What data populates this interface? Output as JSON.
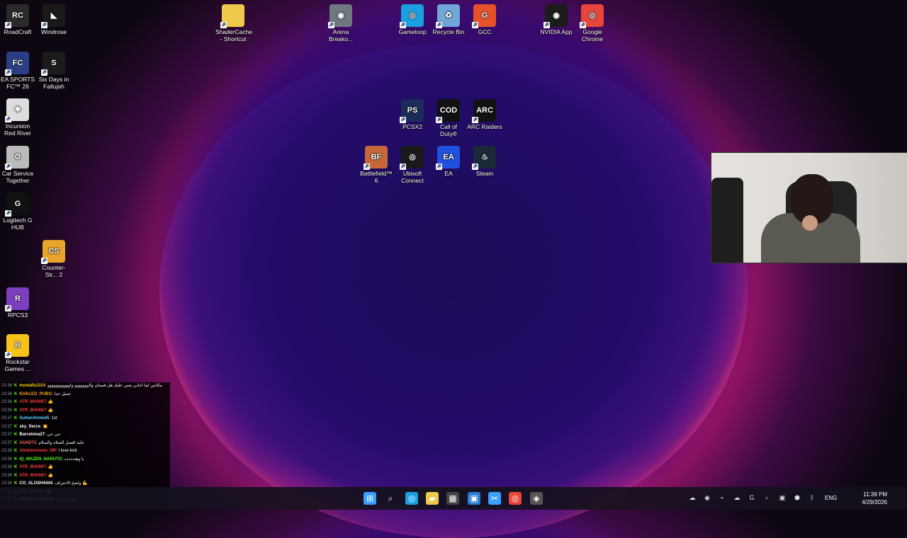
{
  "desktop_icons": [
    {
      "label": "RoadCraft",
      "icon": "roadcraft-icon",
      "color": "#2a2a2a",
      "glyph": "RC"
    },
    {
      "label": "Windrose",
      "icon": "windrose-icon",
      "color": "#1a1a1a",
      "glyph": "◣"
    },
    {
      "label": "ShaderCache - Shortcut",
      "icon": "folder-icon",
      "color": "#f0c94a",
      "glyph": ""
    },
    {
      "label": "Arena Breako...",
      "icon": "arena-breakout-icon",
      "color": "#6f7a80",
      "glyph": "◉"
    },
    {
      "label": "Gameloop",
      "icon": "gameloop-icon",
      "color": "#1aa0e0",
      "glyph": "◎"
    },
    {
      "label": "Recycle Bin",
      "icon": "recycle-bin-icon",
      "color": "#6fa6d6",
      "glyph": "♻"
    },
    {
      "label": "GCC",
      "icon": "gcc-icon",
      "color": "#e5522a",
      "glyph": "G"
    },
    {
      "label": "NVIDIA App",
      "icon": "nvidia-icon",
      "color": "#1c1c1c",
      "glyph": "◉"
    },
    {
      "label": "Google Chrome",
      "icon": "chrome-icon",
      "color": "#e8453c",
      "glyph": "◎"
    },
    {
      "label": "EA SPORTS FC™ 26",
      "icon": "ea-fc-icon",
      "color": "#2b3f86",
      "glyph": "FC"
    },
    {
      "label": "Six Days in Fallujah",
      "icon": "six-days-icon",
      "color": "#1b1b1b",
      "glyph": "S"
    },
    {
      "label": "Incursion Red River",
      "icon": "incursion-icon",
      "color": "#ddd",
      "glyph": "✱"
    },
    {
      "label": "Car Service Together",
      "icon": "car-service-icon",
      "color": "#bbb",
      "glyph": "⚙"
    },
    {
      "label": "Logitech G HUB",
      "icon": "logitech-icon",
      "color": "#111",
      "glyph": "G"
    },
    {
      "label": "Counter-Str... 2",
      "icon": "counter-strike-icon",
      "color": "#e9a42a",
      "glyph": "CS"
    },
    {
      "label": "RPCS3",
      "icon": "rpcs3-icon",
      "color": "#7b3fbf",
      "glyph": "R"
    },
    {
      "label": "Rockstar Games ...",
      "icon": "rockstar-icon",
      "color": "#f7c21a",
      "glyph": "R"
    },
    {
      "label": "PCSX2",
      "icon": "pcsx2-icon",
      "color": "#1b2b5a",
      "glyph": "PS"
    },
    {
      "label": "Call of Duty®",
      "icon": "call-of-duty-icon",
      "color": "#111",
      "glyph": "COD"
    },
    {
      "label": "ARC Raiders",
      "icon": "arc-raiders-icon",
      "color": "#111",
      "glyph": "ARC"
    },
    {
      "label": "Battlefield™ 6",
      "icon": "battlefield-icon",
      "color": "#c7683a",
      "glyph": "BF"
    },
    {
      "label": "Ubisoft Connect",
      "icon": "ubisoft-icon",
      "color": "#1a1a1a",
      "glyph": "◎"
    },
    {
      "label": "EA",
      "icon": "ea-icon",
      "color": "#2050e0",
      "glyph": "EA"
    },
    {
      "label": "Steam",
      "icon": "steam-icon",
      "color": "#1b2838",
      "glyph": "♨"
    }
  ],
  "chat": {
    "messages": [
      {
        "time": "23:36",
        "user": "mostafa1314",
        "color": "#ffd700",
        "text": ": مكانتي لما اجاني يعني عليك هل فستان وااووووووو واووووووووووو"
      },
      {
        "time": "23:36",
        "user": "KHALED_PUBG",
        "color": "#ff9f1a",
        "text": ": جميل جدا"
      },
      {
        "time": "23:36",
        "user": "ATR_MAHI67",
        "color": "#ff3b3b",
        "text": ": 👍"
      },
      {
        "time": "23:36",
        "user": "ATR_MAHI67",
        "color": "#ff3b3b",
        "text": ": 👍"
      },
      {
        "time": "23:37",
        "user": "SultanAhmed5",
        "color": "#5ad1ff",
        "text": ": 1st"
      },
      {
        "time": "23:37",
        "user": "sky_fierce",
        "color": "#ffffff",
        "text": ": 👏"
      },
      {
        "time": "23:37",
        "user": "Barcelona27",
        "color": "#ffffff",
        "text": ": حي حي"
      },
      {
        "time": "23:37",
        "user": "ASAD71",
        "color": "#ff6a6a",
        "text": ": عليه افضل الصلاة والسلام"
      },
      {
        "time": "23:38",
        "user": "Abdelmoneim_NR",
        "color": "#ff3b3b",
        "text": ": I love kick"
      },
      {
        "time": "23:38",
        "user": "IQ_MAZEN_NARUTO",
        "color": "#53fc18",
        "text": ": يا وهدددددد"
      },
      {
        "time": "23:38",
        "user": "ATR_MAHI67",
        "color": "#ff3b3b",
        "text": ": 👍"
      },
      {
        "time": "23:38",
        "user": "ATR_MAHI67",
        "color": "#ff3b3b",
        "text": ": 👍"
      },
      {
        "time": "23:38",
        "user": "CO_ALOSH4444",
        "color": "#ffffff",
        "text": ": واضح الاحتراف 💪"
      },
      {
        "time": "23:38",
        "user": "ATR_FATEH",
        "color": "#5ad1ff",
        "text": ": 😂"
      },
      {
        "time": "23:38",
        "user": "ATRHUSSEN2007",
        "color": "#ffffff",
        "text": ": شوكت نقل"
      }
    ]
  },
  "taskbar": {
    "apps": [
      {
        "icon": "windows-start-icon",
        "color": "#3aa0ff",
        "glyph": "⊞"
      },
      {
        "icon": "search-icon",
        "color": "transparent",
        "glyph": "⌕"
      },
      {
        "icon": "edge-icon",
        "color": "#1aa0e0",
        "glyph": "◎"
      },
      {
        "icon": "file-explorer-icon",
        "color": "#f0c94a",
        "glyph": "▰"
      },
      {
        "icon": "store-icon",
        "color": "#444",
        "glyph": "▦"
      },
      {
        "icon": "photos-icon",
        "color": "#2b7fd6",
        "glyph": "▣"
      },
      {
        "icon": "snipping-tool-icon",
        "color": "#3aa0ff",
        "glyph": "✂"
      },
      {
        "icon": "chrome-icon",
        "color": "#e8453c",
        "glyph": "◎"
      },
      {
        "icon": "app-icon",
        "color": "#555",
        "glyph": "◈"
      }
    ],
    "tray": [
      {
        "icon": "onedrive-icon",
        "glyph": "☁"
      },
      {
        "icon": "nvidia-tray-icon",
        "glyph": "◉"
      },
      {
        "icon": "usb-icon",
        "glyph": "⌁"
      },
      {
        "icon": "cloud-icon",
        "glyph": "☁"
      },
      {
        "icon": "logitech-tray-icon",
        "glyph": "G"
      },
      {
        "icon": "chevron-left-icon",
        "glyph": "‹"
      },
      {
        "icon": "amd-icon",
        "glyph": "▣"
      },
      {
        "icon": "shield-icon",
        "glyph": "⬢"
      },
      {
        "icon": "bluetooth-icon",
        "glyph": "ᛒ"
      }
    ],
    "language": "ENG",
    "time": "11:39 PM",
    "date": "4/29/2026"
  }
}
